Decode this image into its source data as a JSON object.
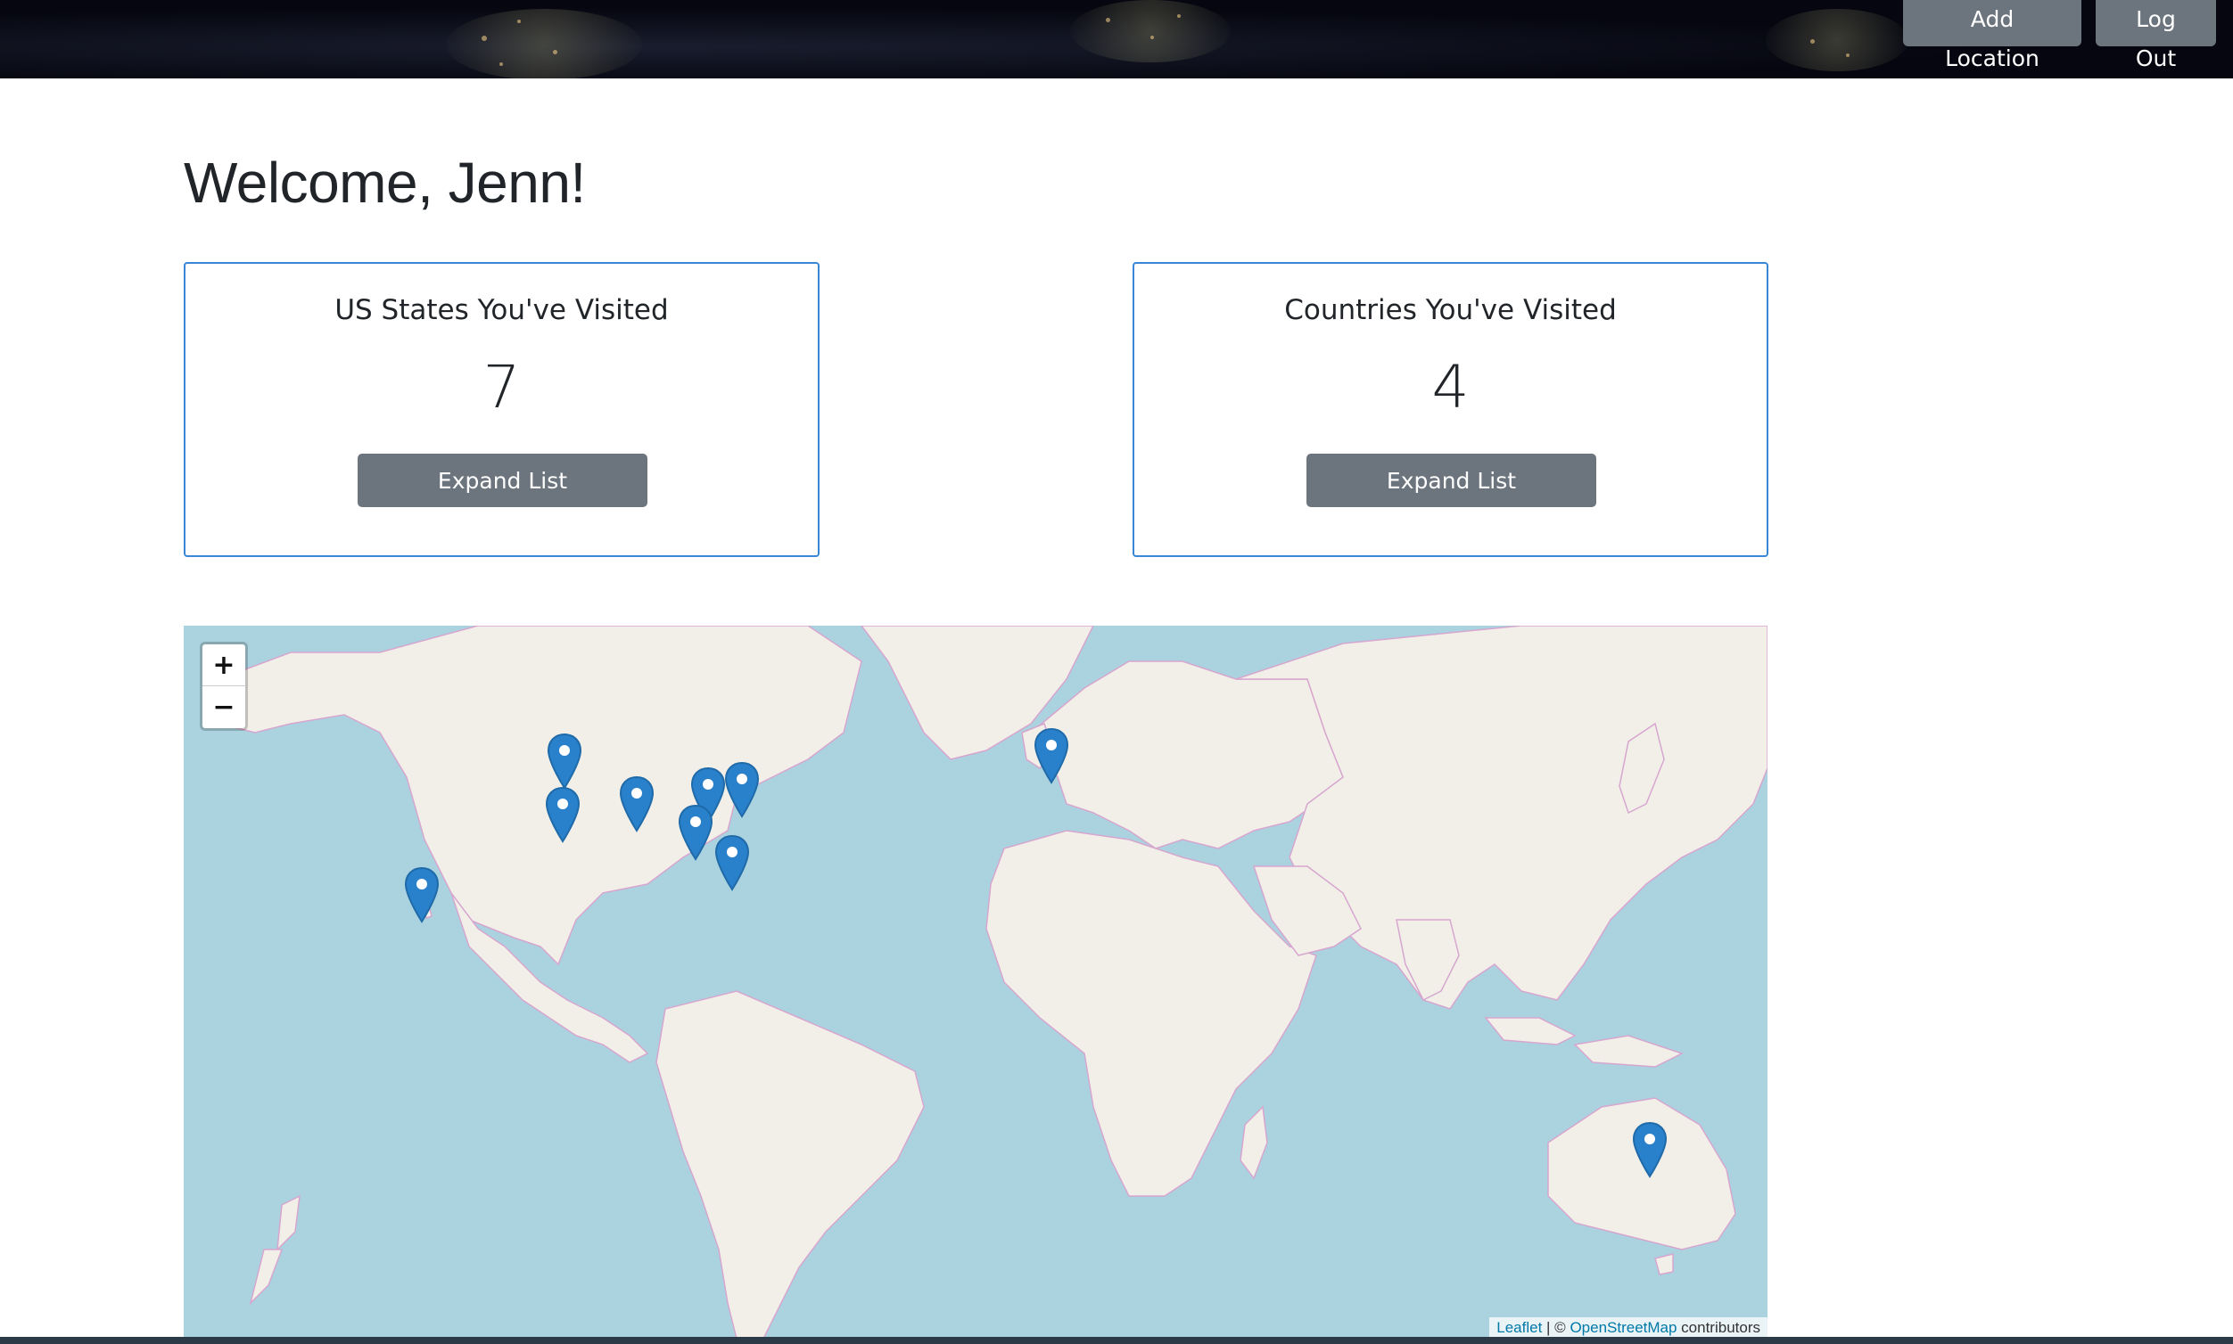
{
  "nav": {
    "add_location_label": "Add Location",
    "log_out_label": "Log Out"
  },
  "welcome": "Welcome, Jenn!",
  "cards": [
    {
      "title": "US States You've Visited",
      "count": "7",
      "button_label": "Expand List"
    },
    {
      "title": "Countries You've Visited",
      "count": "4",
      "button_label": "Expand List"
    }
  ],
  "map": {
    "zoom_in_label": "+",
    "zoom_out_label": "−",
    "attribution": {
      "leaflet": "Leaflet",
      "separator": " | © ",
      "osm": "OpenStreetMap",
      "suffix": " contributors"
    },
    "colors": {
      "water": "#aad3df",
      "land": "#f2efe9",
      "border": "#d7a6cf",
      "marker": "#2a81cb"
    }
  }
}
